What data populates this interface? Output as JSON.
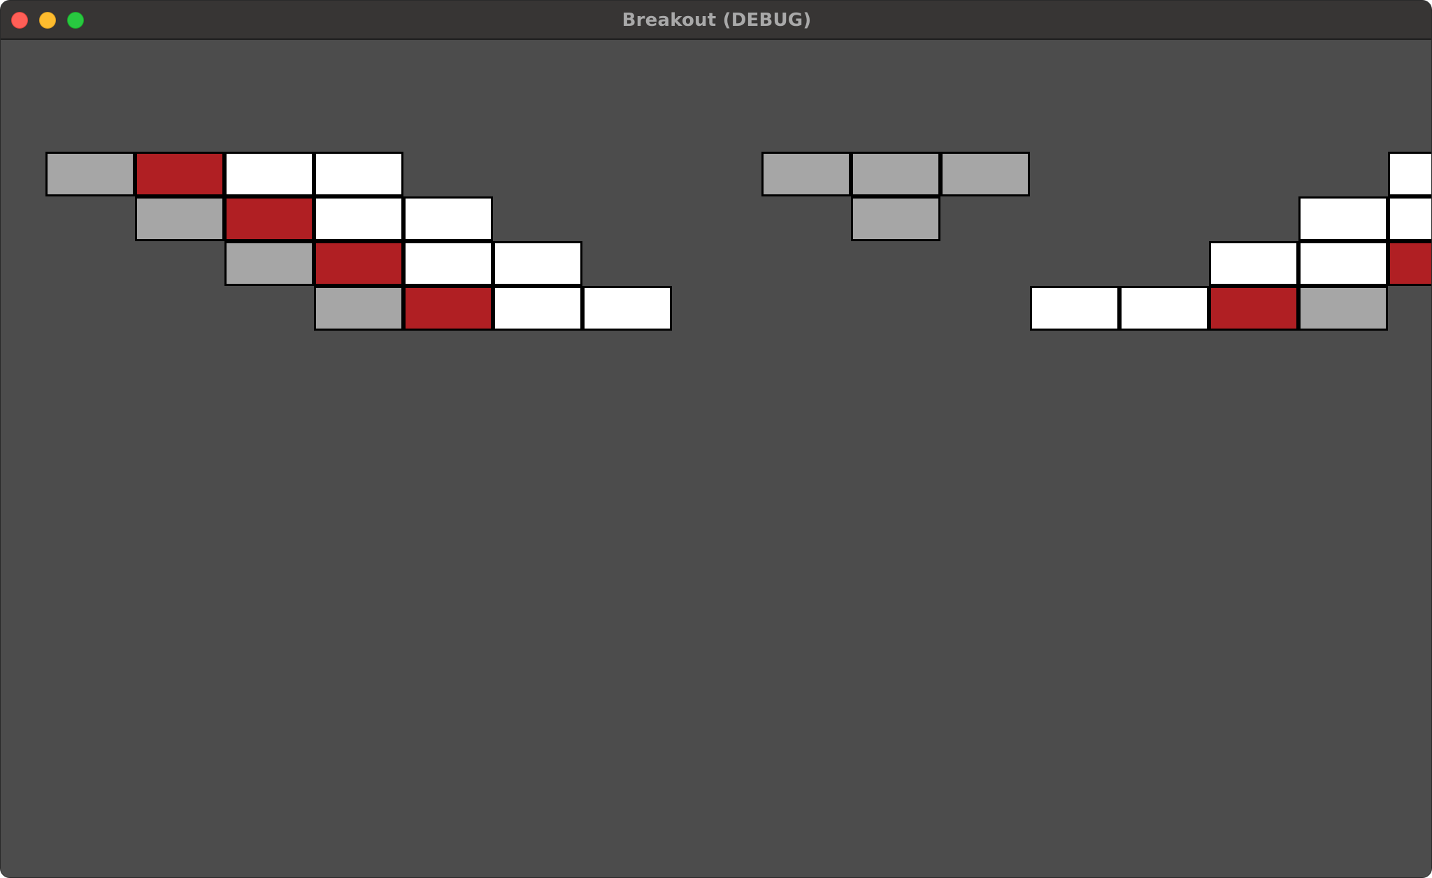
{
  "window": {
    "title": "Breakout (DEBUG)"
  },
  "colors": {
    "background": "#4c4c4c",
    "titlebar": "#373534",
    "brick_grey": "#a6a6a6",
    "brick_red": "#b01f23",
    "brick_white": "#ffffff",
    "brick_border": "#000000"
  },
  "bricks": {
    "rows": [
      "GRWW....GGG....WWRG",
      ".GRWW....G....WWRG.",
      "..GRWW.......WWRG..",
      "...GRWW....WWRG...."
    ]
  }
}
